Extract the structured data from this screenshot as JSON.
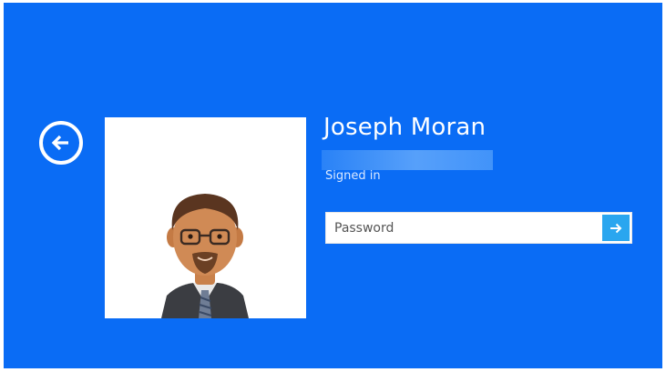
{
  "user": {
    "name": "Joseph Moran",
    "status": "Signed in"
  },
  "password_field": {
    "placeholder": "Password",
    "value": ""
  },
  "colors": {
    "background": "#0a6cf5",
    "submit_button": "#2aa6ef",
    "text": "#ffffff"
  },
  "icons": {
    "back": "back-arrow-icon",
    "submit": "arrow-right-icon",
    "avatar": "user-avatar"
  }
}
